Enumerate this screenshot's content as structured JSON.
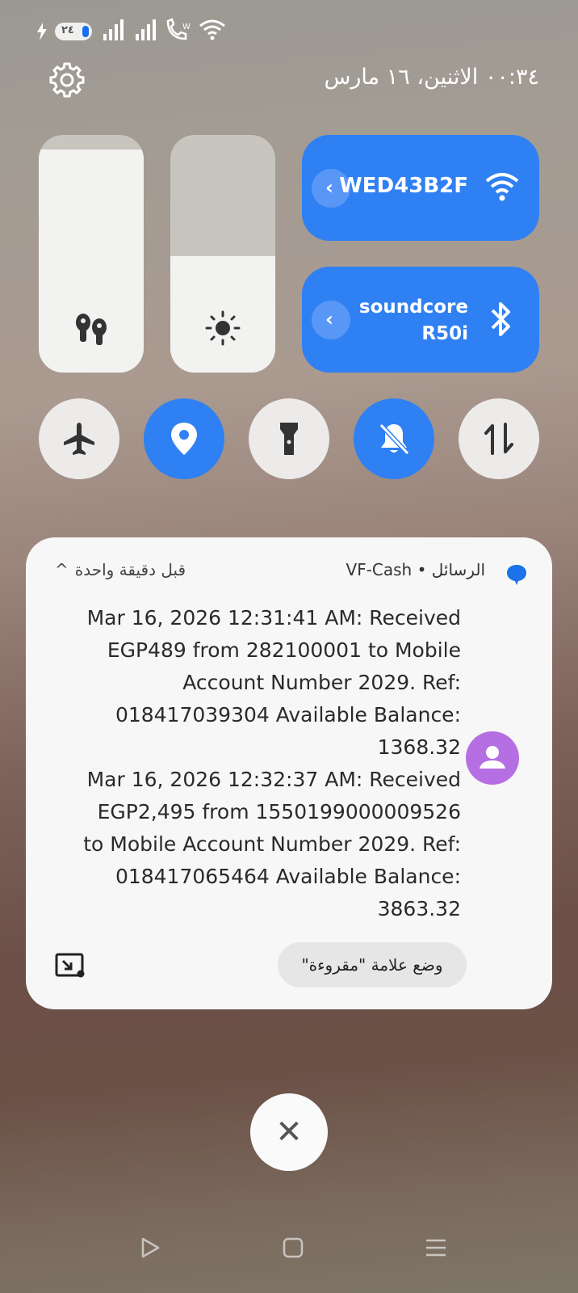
{
  "status_bar": {
    "battery_level": "٢٤"
  },
  "header": {
    "datetime": "٠٠:٣٤ الاثنين، ١٦ مارس"
  },
  "quick_tiles": {
    "wifi": {
      "label": "WED43B2F"
    },
    "bluetooth": {
      "label_line1": "soundcore",
      "label_line2": "R50i"
    },
    "volume_level": 0.94,
    "brightness_level": 0.49
  },
  "toggles": [
    {
      "name": "airplane-mode",
      "on": false
    },
    {
      "name": "location",
      "on": true
    },
    {
      "name": "flashlight",
      "on": false
    },
    {
      "name": "do-not-disturb",
      "on": true
    },
    {
      "name": "mobile-data",
      "on": false
    }
  ],
  "notification": {
    "header": "الرسائل • VF-Cash",
    "time": "قبل دقيقة واحدة",
    "messages": [
      {
        "text": "Mar 16, 2026 12:31:41 AM: Received EGP489 from 282100001 to Mobile Account Number 2029. Ref: 018417039304 Available Balance: 1368.32"
      },
      {
        "text": "Mar 16, 2026 12:32:37 AM: Received EGP2,495 from 1550199000009526 to Mobile Account Number 2029. Ref: 018417065464 Available Balance: 3863.32"
      }
    ],
    "mark_read_label": "وضع علامة \"مقروءة\""
  },
  "clear_all": {
    "symbol": "✕"
  },
  "colors": {
    "accent": "#2f80f3",
    "avatar": "#b66fe2",
    "card": "#f7f7f7"
  }
}
